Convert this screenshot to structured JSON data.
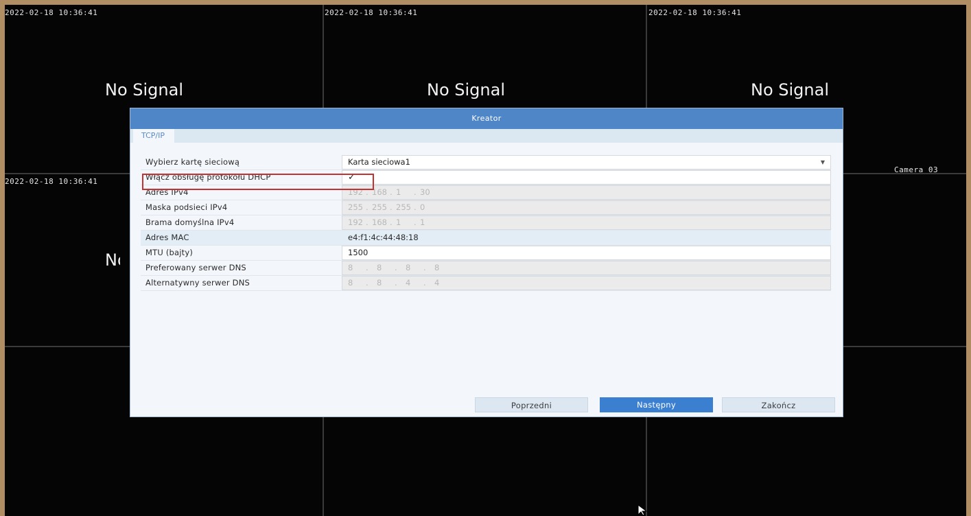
{
  "cameras": {
    "tiles": [
      {
        "timestamp": "2022-02-18 10:36:41",
        "status": "No Signal"
      },
      {
        "timestamp": "2022-02-18 10:36:41",
        "status": "No Signal"
      },
      {
        "timestamp": "2022-02-18 10:36:41",
        "status": "No Signal"
      },
      {
        "timestamp": "2022-02-18 10:36:41",
        "status": "No Signal"
      }
    ],
    "camera_label": "Camera 03"
  },
  "dialog": {
    "title": "Kreator",
    "tab": "TCP/IP",
    "fields": {
      "nic": {
        "label": "Wybierz kartę sieciową",
        "value": "Karta sieciowa1"
      },
      "dhcp": {
        "label": "Włącz obsługę protokołu DHCP",
        "checked": true,
        "check_glyph": "✓"
      },
      "ipv4": {
        "label": "Adres IPv4",
        "octets": [
          "192",
          "168",
          "1",
          "30"
        ]
      },
      "mask": {
        "label": "Maska podsieci IPv4",
        "octets": [
          "255",
          "255",
          "255",
          "0"
        ]
      },
      "gateway": {
        "label": "Brama domyślna IPv4",
        "octets": [
          "192",
          "168",
          "1",
          "1"
        ]
      },
      "mac": {
        "label": "Adres MAC",
        "value": "e4:f1:4c:44:48:18"
      },
      "mtu": {
        "label": "MTU (bajty)",
        "value": "1500"
      },
      "dns_pref": {
        "label": "Preferowany serwer DNS",
        "octets": [
          "8",
          "8",
          "8",
          "8"
        ]
      },
      "dns_alt": {
        "label": "Alternatywny serwer DNS",
        "octets": [
          "8",
          "8",
          "4",
          "4"
        ]
      }
    },
    "buttons": {
      "prev": "Poprzedni",
      "next": "Następny",
      "finish": "Zakończ"
    }
  },
  "colors": {
    "title_bar": "#4e86c8",
    "primary_button": "#3b7fd1",
    "highlight_box": "#c33131"
  }
}
